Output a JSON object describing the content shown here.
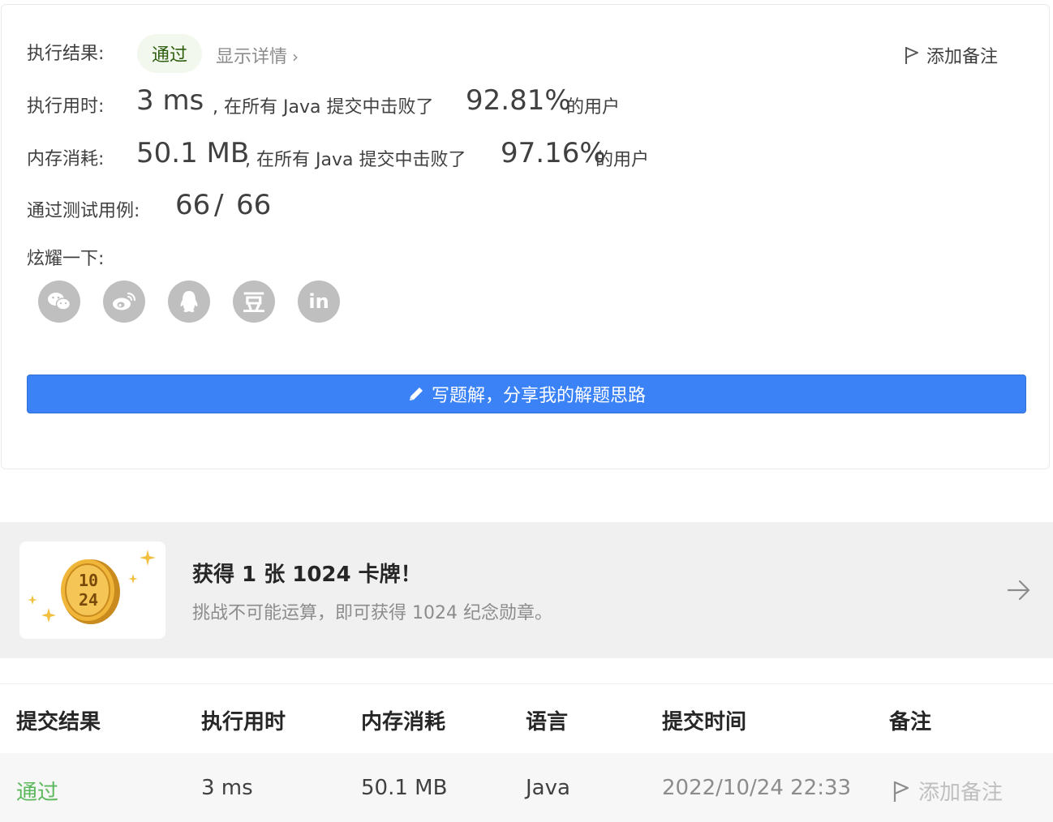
{
  "result": {
    "label": "执行结果:",
    "status": "通过",
    "details_link": "显示详情",
    "add_note": "添加备注"
  },
  "runtime": {
    "label": "执行用时:",
    "value": "3 ms",
    "text_before": ", 在所有 Java 提交中击败了",
    "percent": "92.81%",
    "text_after": "的用户"
  },
  "memory": {
    "label": "内存消耗:",
    "value": "50.1 MB",
    "text_before": ", 在所有 Java 提交中击败了",
    "percent": "97.16%",
    "text_after": "的用户"
  },
  "testcases": {
    "label": "通过测试用例:",
    "passed": "66",
    "separator": "/",
    "total": "66"
  },
  "share": {
    "label": "炫耀一下:",
    "icons": [
      "wechat-icon",
      "weibo-icon",
      "qq-icon",
      "douban-icon",
      "linkedin-icon"
    ],
    "douban_glyph": "豆",
    "linkedin_glyph": "in"
  },
  "write_solution_button": "写题解，分享我的解题思路",
  "banner": {
    "title": "获得 1 张 1024 卡牌！",
    "subtitle": "挑战不可能运算，即可获得 1024 纪念勋章。",
    "coin_top": "10",
    "coin_bottom": "24"
  },
  "table": {
    "headers": [
      "提交结果",
      "执行用时",
      "内存消耗",
      "语言",
      "提交时间",
      "备注"
    ],
    "row": {
      "result": "通过",
      "runtime": "3 ms",
      "memory": "50.1 MB",
      "language": "Java",
      "time": "2022/10/24 22:33",
      "note": "添加备注"
    }
  },
  "colors": {
    "accent": "#3b82f6",
    "pass_green": "#5cb85c",
    "icon_gray": "#bfbfbf",
    "banner_bg": "#f0f0f0"
  }
}
